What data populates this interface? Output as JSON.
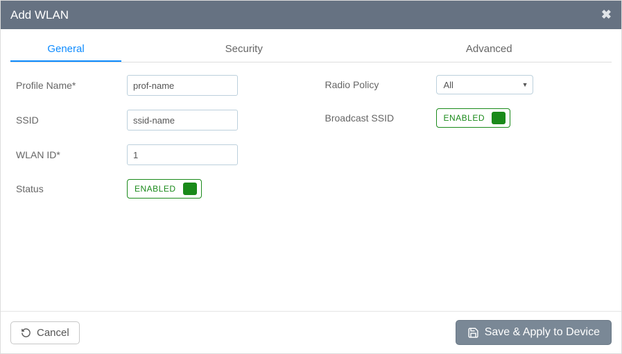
{
  "header": {
    "title": "Add WLAN"
  },
  "tabs": [
    {
      "label": "General",
      "active": true
    },
    {
      "label": "Security",
      "active": false
    },
    {
      "label": "Advanced",
      "active": false
    }
  ],
  "form": {
    "left": {
      "profile_name": {
        "label": "Profile Name*",
        "value": "prof-name"
      },
      "ssid": {
        "label": "SSID",
        "value": "ssid-name"
      },
      "wlan_id": {
        "label": "WLAN ID*",
        "value": "1"
      },
      "status": {
        "label": "Status",
        "value": "ENABLED"
      }
    },
    "right": {
      "radio_policy": {
        "label": "Radio Policy",
        "value": "All",
        "options": [
          "All"
        ]
      },
      "broadcast_ssid": {
        "label": "Broadcast SSID",
        "value": "ENABLED"
      }
    }
  },
  "footer": {
    "cancel": "Cancel",
    "save": "Save & Apply to Device"
  }
}
